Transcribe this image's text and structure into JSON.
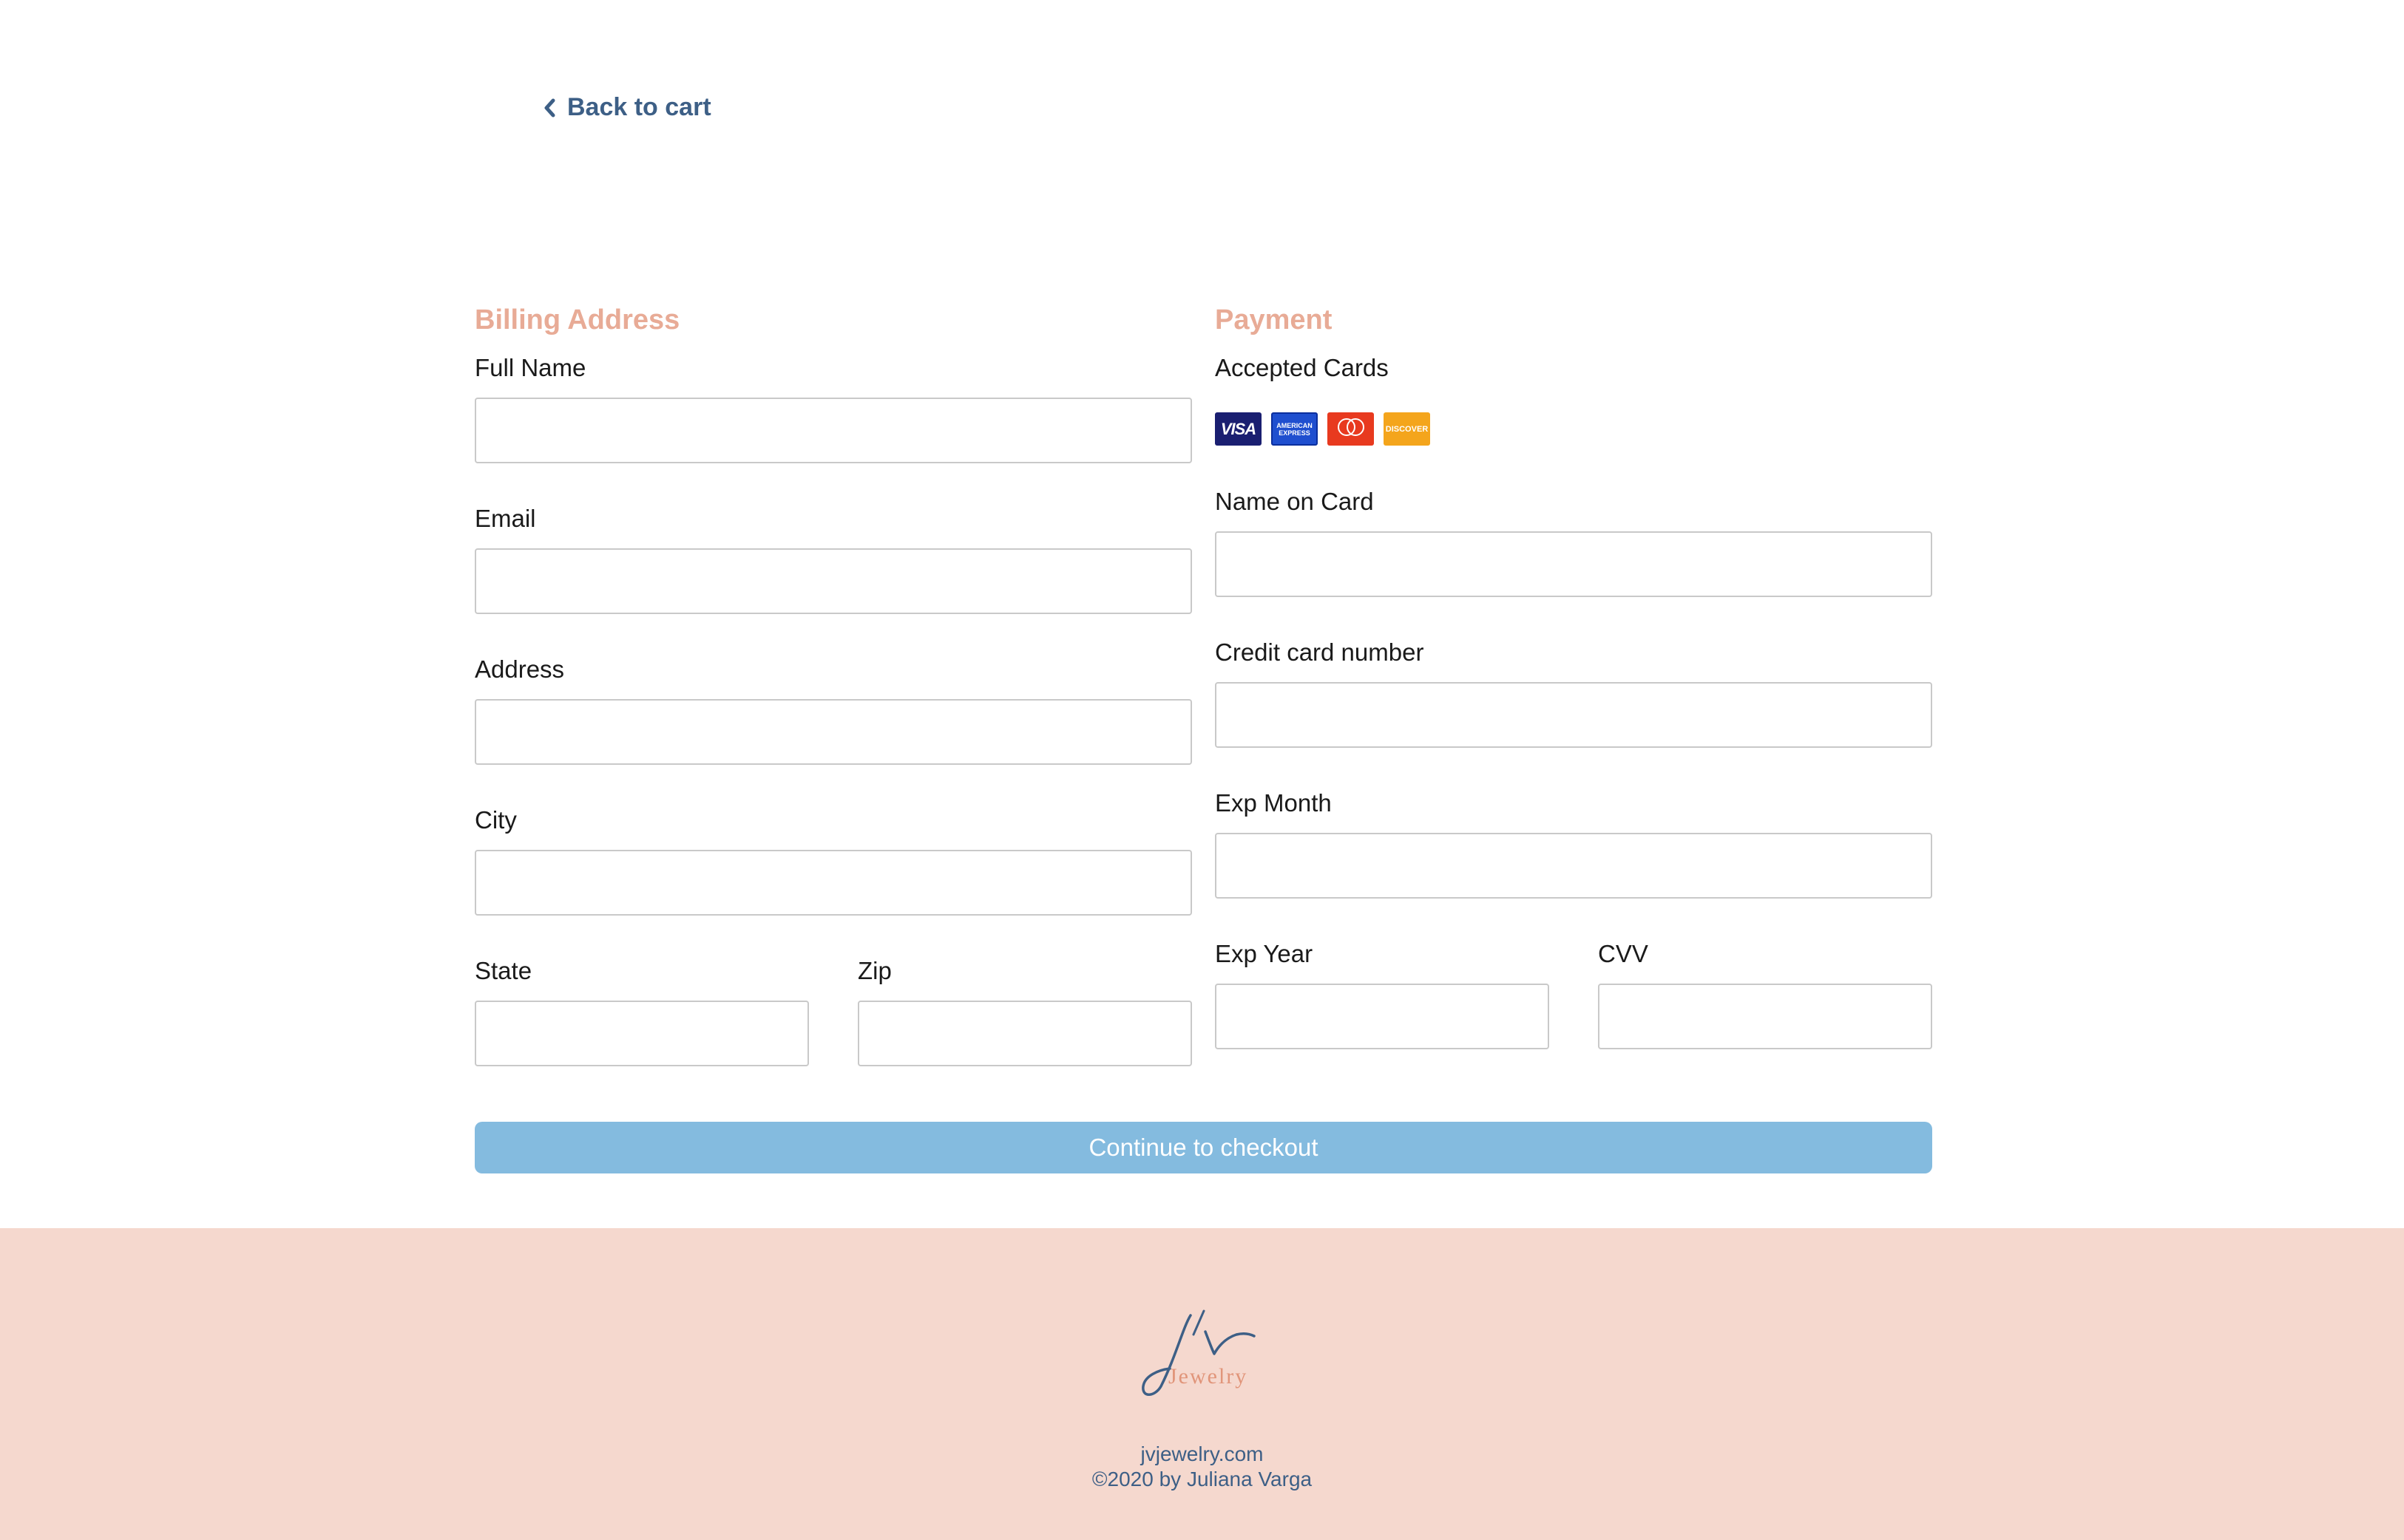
{
  "nav": {
    "back_label": "Back to cart"
  },
  "billing": {
    "title": "Billing Address",
    "fields": {
      "full_name": {
        "label": "Full Name",
        "value": ""
      },
      "email": {
        "label": "Email",
        "value": ""
      },
      "address": {
        "label": "Address",
        "value": ""
      },
      "city": {
        "label": "City",
        "value": ""
      },
      "state": {
        "label": "State",
        "value": ""
      },
      "zip": {
        "label": "Zip",
        "value": ""
      }
    }
  },
  "payment": {
    "title": "Payment",
    "accepted_cards_label": "Accepted Cards",
    "cards": [
      {
        "name": "VISA",
        "icon": "visa-icon"
      },
      {
        "name": "AMERICAN EXPRESS",
        "icon": "amex-icon"
      },
      {
        "name": "mastercard",
        "icon": "mastercard-icon"
      },
      {
        "name": "DISCOVER",
        "icon": "discover-icon"
      }
    ],
    "fields": {
      "name_on_card": {
        "label": "Name on Card",
        "value": ""
      },
      "card_number": {
        "label": "Credit card number",
        "value": ""
      },
      "exp_month": {
        "label": "Exp Month",
        "value": ""
      },
      "exp_year": {
        "label": "Exp Year",
        "value": ""
      },
      "cvv": {
        "label": "CVV",
        "value": ""
      }
    }
  },
  "actions": {
    "checkout_label": "Continue to checkout"
  },
  "footer": {
    "logo_text": "Jewelry",
    "site": "jvjewelry.com",
    "copyright": "©2020 by Juliana Varga"
  },
  "colors": {
    "accent_title": "#e8ab96",
    "link": "#3d5f86",
    "button": "#84bbdf",
    "footer_bg": "#f5d8ce"
  }
}
